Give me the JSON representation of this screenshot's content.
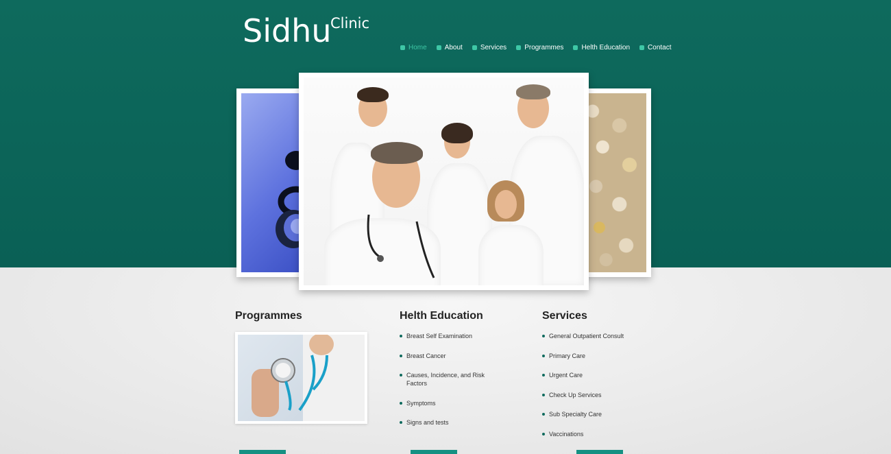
{
  "brand": {
    "name": "Sidhu",
    "subtitle": "Clinic"
  },
  "nav": {
    "items": [
      {
        "label": "Home",
        "active": true
      },
      {
        "label": "About",
        "active": false
      },
      {
        "label": "Services",
        "active": false
      },
      {
        "label": "Programmes",
        "active": false
      },
      {
        "label": "Helth Education",
        "active": false
      },
      {
        "label": "Contact",
        "active": false
      }
    ]
  },
  "columns": {
    "programmes": {
      "title": "Programmes"
    },
    "health_education": {
      "title": "Helth Education",
      "items": [
        "Breast Self Examination",
        "Breast Cancer",
        "Causes, Incidence, and Risk Factors",
        "Symptoms",
        "Signs and tests"
      ]
    },
    "services": {
      "title": "Services",
      "items": [
        "General Outpatient Consult",
        "Primary Care",
        "Urgent Care",
        "Check Up Services",
        "Sub Specialty Care",
        "Vaccinations"
      ]
    }
  },
  "colors": {
    "header_bg": "#0e6a5d",
    "accent": "#3ec7a6",
    "button": "#159183"
  }
}
